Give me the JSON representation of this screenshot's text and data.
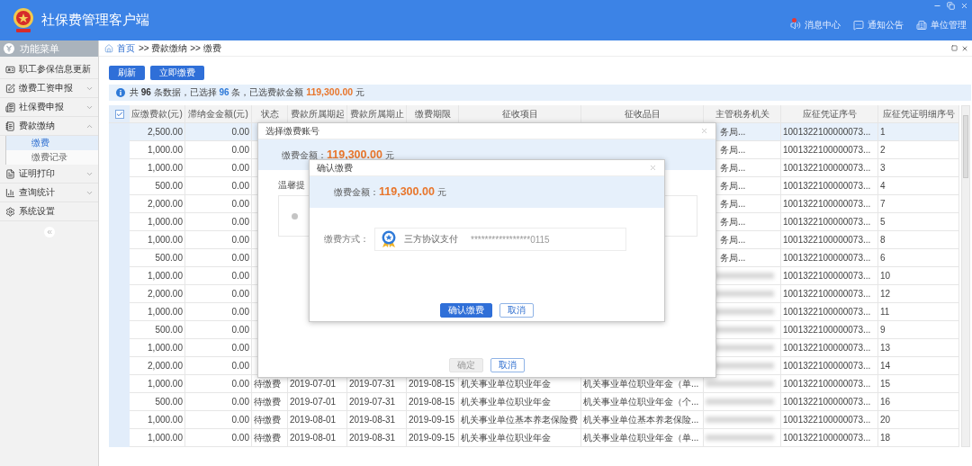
{
  "window": {
    "title": "社保费管理客户端"
  },
  "header_links": [
    {
      "label": "消息中心",
      "badge": true
    },
    {
      "label": "通知公告",
      "badge": false
    },
    {
      "label": "单位管理",
      "badge": false
    }
  ],
  "sidebar": {
    "title": "功能菜单",
    "items": [
      {
        "label": "职工参保信息更新"
      },
      {
        "label": "缴费工资申报",
        "expanded": false
      },
      {
        "label": "社保费申报",
        "expanded": false
      },
      {
        "label": "费款缴纳",
        "expanded": true,
        "children": [
          {
            "label": "缴费",
            "selected": true
          },
          {
            "label": "缴费记录",
            "selected": false
          }
        ]
      },
      {
        "label": "证明打印",
        "expanded": false
      },
      {
        "label": "查询统计",
        "expanded": false
      },
      {
        "label": "系统设置"
      }
    ]
  },
  "breadcrumb": [
    {
      "label": "首页",
      "kind": "link"
    },
    {
      "label": ">> 费款缴纳 >> 缴费",
      "kind": "text"
    }
  ],
  "toolbar": [
    "刷新",
    "立即缴费"
  ],
  "info": [
    {
      "text": "共 ",
      "kind": "plain"
    },
    {
      "text": "96",
      "kind": "strong"
    },
    {
      "text": " 条数据，已选择 ",
      "kind": "plain"
    },
    {
      "text": "96",
      "kind": "count"
    },
    {
      "text": " 条，已选费款金额 ",
      "kind": "plain"
    },
    {
      "text": "119,300.00",
      "kind": "amount"
    },
    {
      "text": " 元",
      "kind": "plain"
    }
  ],
  "table": {
    "all_checked": true,
    "columns": [
      "应缴费款(元)",
      "滞纳金金额(元)",
      "状态",
      "费款所属期起",
      "费款所属期止",
      "缴费期限",
      "征收项目",
      "征收品目",
      "主管税务机关",
      "应征凭证序号",
      "应征凭证明细序号"
    ],
    "rows": [
      {
        "selected": true,
        "amount": "2,500.00",
        "late_fee": "0.00",
        "tax_office": "务局...",
        "voucher": "1001322100000073...",
        "detail": "1"
      },
      {
        "selected": false,
        "amount": "1,000.00",
        "late_fee": "0.00",
        "tax_office": "务局...",
        "voucher": "1001322100000073...",
        "detail": "2"
      },
      {
        "selected": false,
        "amount": "1,000.00",
        "late_fee": "0.00",
        "tax_office": "务局...",
        "voucher": "1001322100000073...",
        "detail": "3"
      },
      {
        "selected": false,
        "amount": "500.00",
        "late_fee": "0.00",
        "tax_office": "务局...",
        "voucher": "1001322100000073...",
        "detail": "4"
      },
      {
        "selected": false,
        "amount": "2,000.00",
        "late_fee": "0.00",
        "tax_office": "务局...",
        "voucher": "1001322100000073...",
        "detail": "7"
      },
      {
        "selected": false,
        "amount": "1,000.00",
        "late_fee": "0.00",
        "tax_office": "务局...",
        "voucher": "1001322100000073...",
        "detail": "5"
      },
      {
        "selected": false,
        "amount": "1,000.00",
        "late_fee": "0.00",
        "tax_office": "务局...",
        "voucher": "1001322100000073...",
        "detail": "8"
      },
      {
        "selected": false,
        "amount": "500.00",
        "late_fee": "0.00",
        "tax_office": "务局...",
        "voucher": "1001322100000073...",
        "detail": "6"
      },
      {
        "selected": false,
        "amount": "1,000.00",
        "late_fee": "0.00",
        "voucher": "1001322100000073...",
        "detail": "10"
      },
      {
        "selected": false,
        "amount": "2,000.00",
        "late_fee": "0.00",
        "voucher": "1001322100000073...",
        "detail": "12"
      },
      {
        "selected": false,
        "amount": "1,000.00",
        "late_fee": "0.00",
        "voucher": "1001322100000073...",
        "detail": "11"
      },
      {
        "selected": false,
        "amount": "500.00",
        "late_fee": "0.00",
        "voucher": "1001322100000073...",
        "detail": "9"
      },
      {
        "selected": false,
        "amount": "1,000.00",
        "late_fee": "0.00",
        "voucher": "1001322100000073...",
        "detail": "13"
      },
      {
        "selected": false,
        "amount": "2,000.00",
        "late_fee": "0.00",
        "voucher": "1001322100000073...",
        "detail": "14"
      },
      {
        "selected": false,
        "amount": "1,000.00",
        "late_fee": "0.00",
        "status": "待缴费",
        "start": "2019-07-01",
        "end": "2019-07-31",
        "deadline": "2019-08-15",
        "item": "机关事业单位职业年金",
        "subitem": "机关事业单位职业年金（单...",
        "voucher": "1001322100000073...",
        "detail": "15"
      },
      {
        "selected": false,
        "amount": "500.00",
        "late_fee": "0.00",
        "status": "待缴费",
        "start": "2019-07-01",
        "end": "2019-07-31",
        "deadline": "2019-08-15",
        "item": "机关事业单位职业年金",
        "subitem": "机关事业单位职业年金（个...",
        "voucher": "1001322100000073...",
        "detail": "16"
      },
      {
        "selected": false,
        "amount": "1,000.00",
        "late_fee": "0.00",
        "status": "待缴费",
        "start": "2019-08-01",
        "end": "2019-08-31",
        "deadline": "2019-09-15",
        "item": "机关事业单位基本养老保险费",
        "subitem": "机关事业单位基本养老保险...",
        "voucher": "1001322100000073...",
        "detail": "20"
      },
      {
        "selected": false,
        "amount": "1,000.00",
        "late_fee": "0.00",
        "status": "待缴费",
        "start": "2019-08-01",
        "end": "2019-08-31",
        "deadline": "2019-09-15",
        "item": "机关事业单位职业年金",
        "subitem": "机关事业单位职业年金（单...",
        "voucher": "1001322100000073...",
        "detail": "18"
      }
    ]
  },
  "pay_account_dialog": {
    "title": "选择缴费账号",
    "amount_label": "缴费金额：",
    "amount": "119,300.00",
    "unit": "元",
    "tip": "温馨提",
    "options": [
      {
        "selected": false
      }
    ],
    "buttons": [
      {
        "label": "确定",
        "disabled": true
      },
      {
        "label": "取消",
        "disabled": false
      }
    ]
  },
  "confirm_dialog": {
    "title": "确认缴费",
    "amount_label": "缴费金额：",
    "amount": "119,300.00",
    "unit": "元",
    "method_label": "缴费方式：",
    "method": "三方协议支付",
    "account": "*****************0115",
    "buttons": [
      {
        "label": "确认缴费",
        "kind": "primary"
      },
      {
        "label": "取消",
        "kind": "secondary"
      }
    ]
  }
}
